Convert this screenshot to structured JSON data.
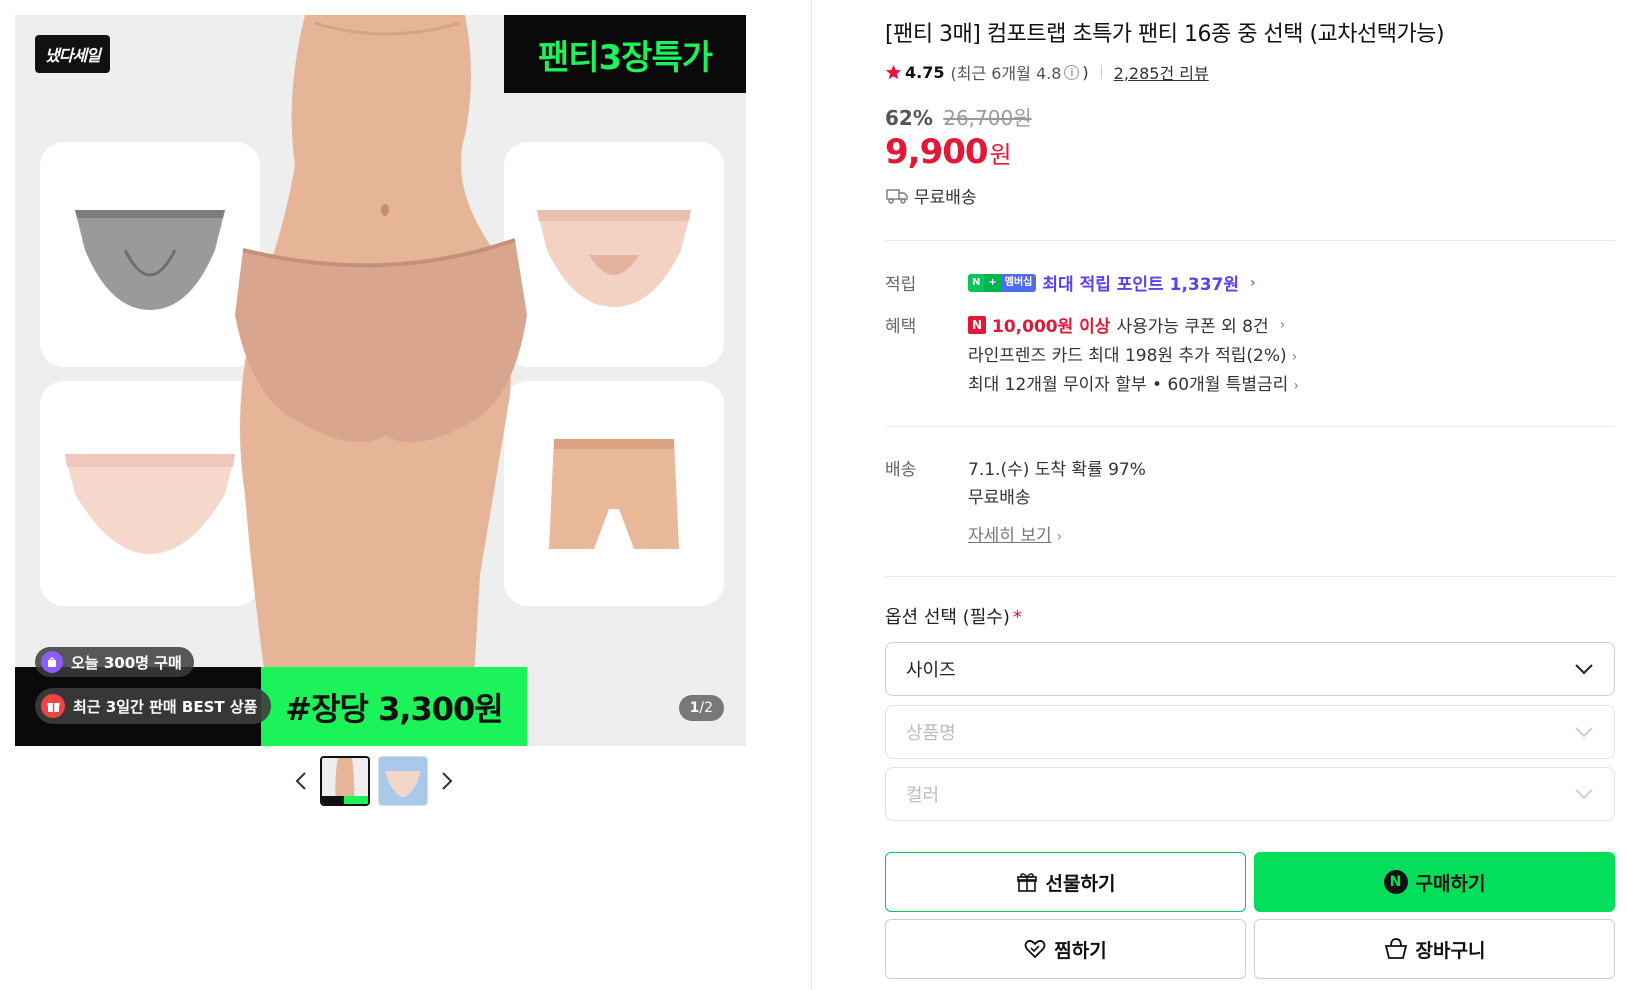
{
  "gallery": {
    "sale_logo": "냈다세일",
    "promo_tag": "팬티3장특가",
    "buy_badge": "오늘 300명 구매",
    "best_badge": "최근 3일간 판매 BEST 상품",
    "banner_price": "#장당 3,300원",
    "pager_current": "1",
    "pager_total": "/2"
  },
  "product": {
    "title": "[팬티 3매] 컴포트랩 초특가 팬티 16종 중 선택 (교차선택가능)",
    "rating": "4.75",
    "rating_recent": "(최근 6개월 4.8",
    "rating_recent_close": ")",
    "reviews": "2,285건 리뷰",
    "discount_rate": "62%",
    "original_price": "26,700원",
    "price": "9,900",
    "price_unit": "원",
    "shipping": "무료배송"
  },
  "benefits": {
    "points_label": "적립",
    "nplus_left": "N",
    "nplus_mid": "+",
    "nplus_right": "멤버십",
    "points_text": "최대 적립 포인트 1,337원",
    "benefit_label": "혜택",
    "coupon_strong": "10,000원 이상",
    "coupon_rest": "사용가능 쿠폰 외 8건",
    "card": "라인프렌즈 카드 최대 198원 추가 적립(2%)",
    "installment": "최대 12개월 무이자 할부 • 60개월 특별금리"
  },
  "delivery": {
    "label": "배송",
    "arrival": "7.1.(수) 도착 확률 97%",
    "fee": "무료배송",
    "detail_link": "자세히 보기"
  },
  "options": {
    "label": "옵션 선택 (필수)",
    "required_mark": "*",
    "size_placeholder": "사이즈",
    "product_placeholder": "상품명",
    "color_placeholder": "컬러"
  },
  "actions": {
    "gift": "선물하기",
    "buy": "구매하기",
    "wish": "찜하기",
    "cart": "장바구니"
  },
  "colors": {
    "accent_green": "#03df5a",
    "price_red": "#e31837",
    "point_purple": "#5b3ff5"
  }
}
